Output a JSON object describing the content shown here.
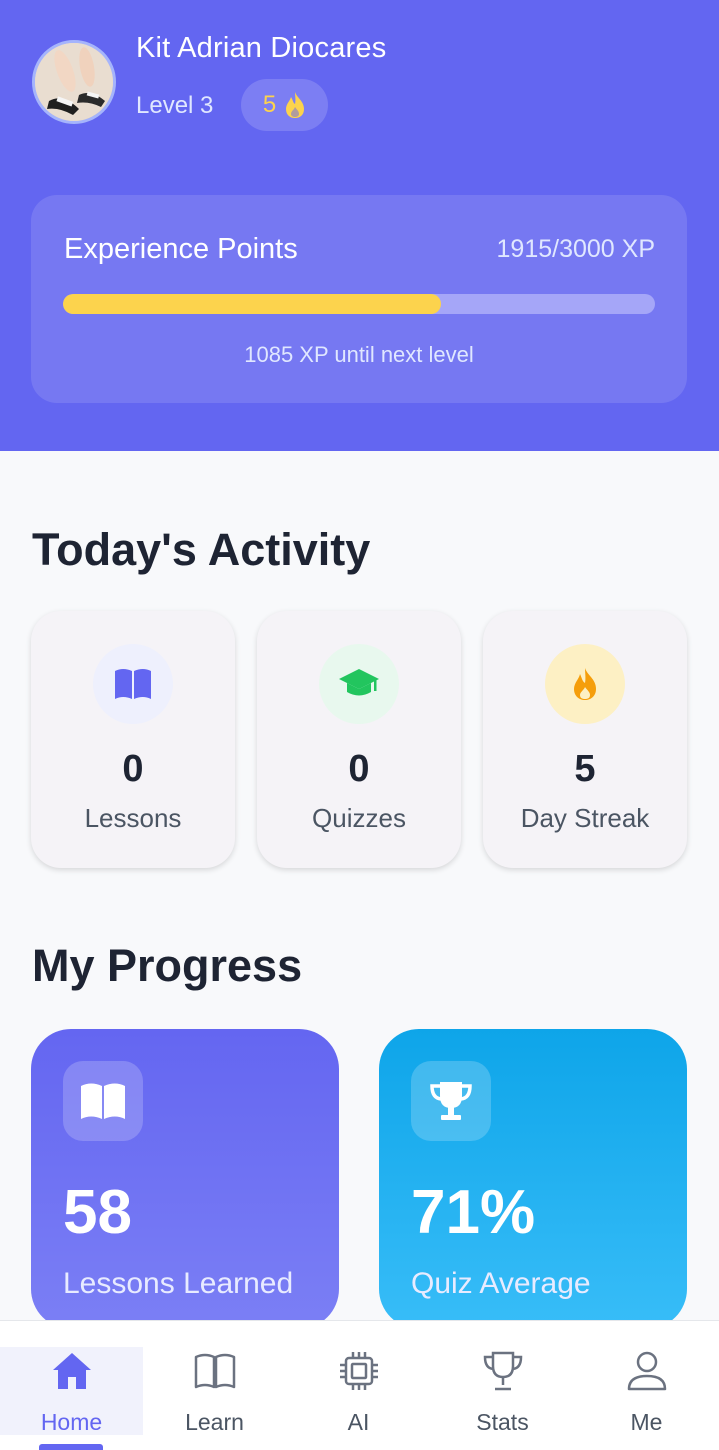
{
  "user": {
    "name": "Kit Adrian Diocares",
    "level": "Level 3",
    "streak": "5"
  },
  "xp": {
    "title": "Experience Points",
    "value": "1915/3000 XP",
    "current": 1915,
    "max": 3000,
    "remaining": "1085 XP until next level"
  },
  "today": {
    "title": "Today's Activity",
    "items": [
      {
        "value": "0",
        "label": "Lessons",
        "icon": "book-icon",
        "color": "#6366f1"
      },
      {
        "value": "0",
        "label": "Quizzes",
        "icon": "graduation-cap-icon",
        "color": "#22c55e"
      },
      {
        "value": "5",
        "label": "Day Streak",
        "icon": "flame-icon",
        "color": "#f59e0b"
      }
    ]
  },
  "progress": {
    "title": "My Progress",
    "items": [
      {
        "value": "58",
        "label": "Lessons Learned",
        "icon": "book-icon"
      },
      {
        "value": "71%",
        "label": "Quiz Average",
        "icon": "trophy-icon"
      }
    ]
  },
  "nav": {
    "items": [
      {
        "label": "Home",
        "icon": "home-icon",
        "active": true
      },
      {
        "label": "Learn",
        "icon": "book-icon"
      },
      {
        "label": "AI",
        "icon": "chip-icon"
      },
      {
        "label": "Stats",
        "icon": "trophy-icon"
      },
      {
        "label": "Me",
        "icon": "user-icon"
      }
    ]
  },
  "colors": {
    "primary": "#6366f1",
    "quiz": "#0ea5e9",
    "accent_yellow": "#fcd34d"
  }
}
